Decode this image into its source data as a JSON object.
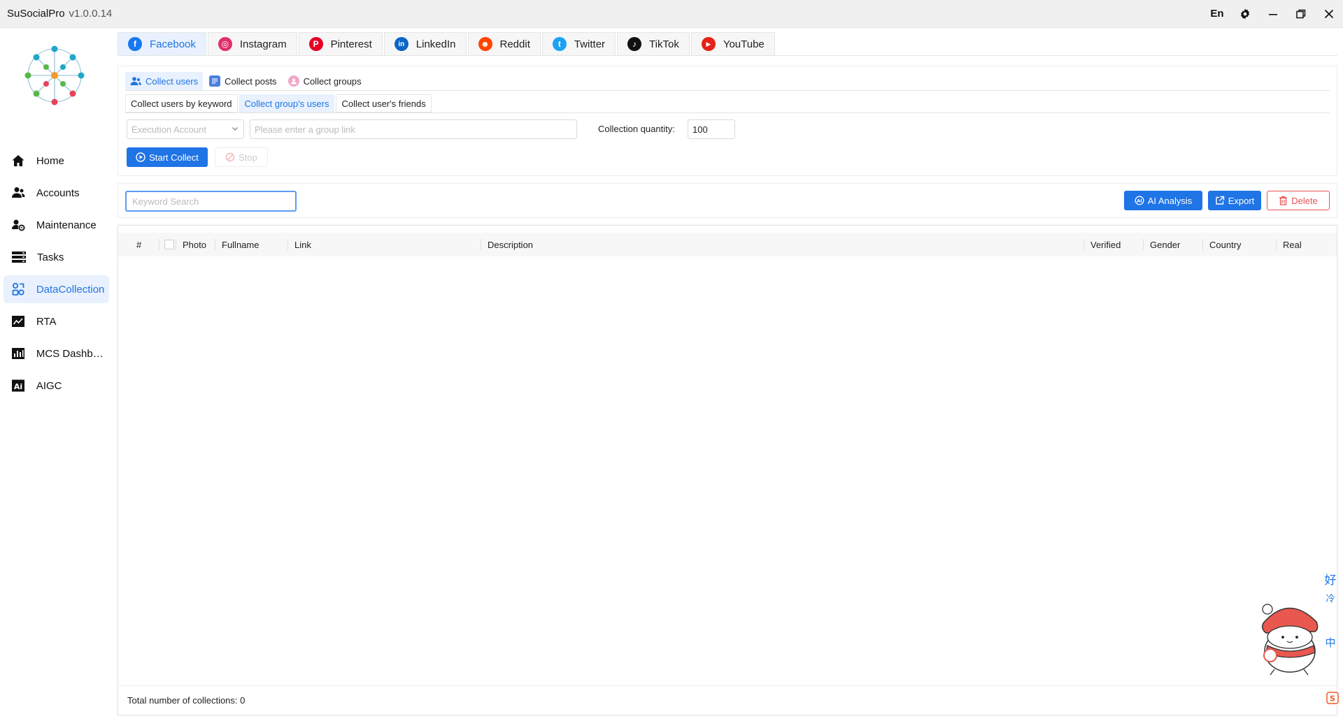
{
  "titlebar": {
    "app_name": "SuSocialPro",
    "version": "v1.0.0.14",
    "language": "En"
  },
  "sidebar": {
    "items": [
      {
        "label": "Home",
        "icon": "home-icon"
      },
      {
        "label": "Accounts",
        "icon": "users-icon"
      },
      {
        "label": "Maintenance",
        "icon": "user-gear-icon"
      },
      {
        "label": "Tasks",
        "icon": "server-icon"
      },
      {
        "label": "DataCollection",
        "icon": "data-collection-icon",
        "active": true
      },
      {
        "label": "RTA",
        "icon": "line-chart-icon"
      },
      {
        "label": "MCS Dashboard",
        "icon": "bar-chart-icon"
      },
      {
        "label": "AIGC",
        "icon": "ai-icon"
      }
    ]
  },
  "platform_tabs": [
    {
      "label": "Facebook",
      "color": "#1877f2",
      "glyph": "f",
      "active": true
    },
    {
      "label": "Instagram",
      "color": "#e1306c",
      "glyph": "◎"
    },
    {
      "label": "Pinterest",
      "color": "#e60023",
      "glyph": "P"
    },
    {
      "label": "LinkedIn",
      "color": "#0a66c2",
      "glyph": "in"
    },
    {
      "label": "Reddit",
      "color": "#ff4500",
      "glyph": "☻"
    },
    {
      "label": "Twitter",
      "color": "#1da1f2",
      "glyph": "t"
    },
    {
      "label": "TikTok",
      "color": "#111111",
      "glyph": "♪"
    },
    {
      "label": "YouTube",
      "color": "#e62117",
      "glyph": "▶"
    }
  ],
  "collect_tabs": {
    "users": "Collect users",
    "posts": "Collect posts",
    "groups": "Collect groups"
  },
  "sub_tabs": {
    "by_keyword": "Collect users by keyword",
    "group_users": "Collect group's users",
    "user_friends": "Collect user's friends"
  },
  "form": {
    "account_placeholder": "Execution Account",
    "group_link_placeholder": "Please enter a group link",
    "quantity_label": "Collection quantity:",
    "quantity_value": "100",
    "start_label": "Start Collect",
    "stop_label": "Stop"
  },
  "search": {
    "placeholder": "Keyword Search",
    "ai_label": "AI Analysis",
    "export_label": "Export",
    "delete_label": "Delete"
  },
  "table": {
    "columns": {
      "index": "#",
      "photo": "Photo",
      "fullname": "Fullname",
      "link": "Link",
      "description": "Description",
      "verified": "Verified",
      "gender": "Gender",
      "country": "Country",
      "real": "Real"
    },
    "footer": "Total number of collections: 0"
  },
  "widget": {
    "chars": [
      "好",
      "冷",
      "中"
    ]
  },
  "colors": {
    "accent": "#1f74e6",
    "danger": "#e65454"
  }
}
